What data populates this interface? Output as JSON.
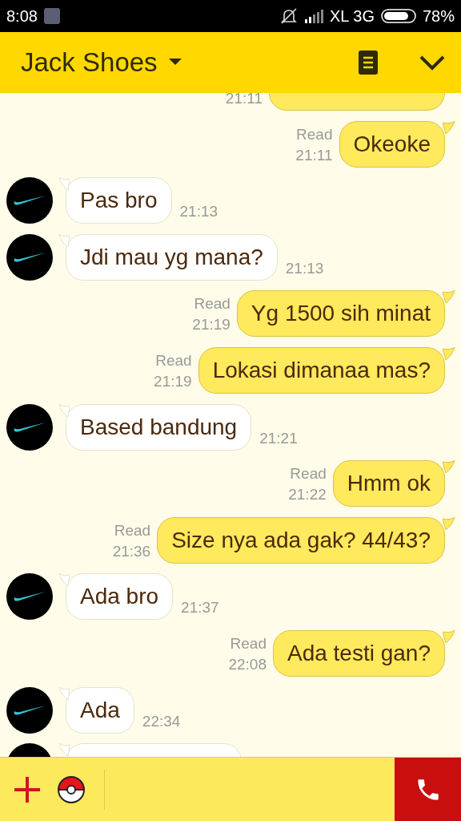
{
  "status_bar": {
    "time": "8:08",
    "network": "XL 3G",
    "battery": "78%"
  },
  "header": {
    "title": "Jack Shoes"
  },
  "messages": [
    {
      "kind": "clipped",
      "time": "21:11"
    },
    {
      "kind": "outgoing",
      "text": "Okeoke",
      "read": "Read",
      "time": "21:11"
    },
    {
      "kind": "incoming",
      "text": "Pas bro",
      "time": "21:13"
    },
    {
      "kind": "incoming",
      "text": "Jdi mau yg mana?",
      "time": "21:13"
    },
    {
      "kind": "outgoing",
      "text": "Yg 1500 sih minat",
      "read": "Read",
      "time": "21:19"
    },
    {
      "kind": "outgoing",
      "text": "Lokasi dimanaa mas?",
      "read": "Read",
      "time": "21:19"
    },
    {
      "kind": "incoming",
      "text": "Based bandung",
      "time": "21:21"
    },
    {
      "kind": "outgoing",
      "text": "Hmm ok",
      "read": "Read",
      "time": "21:22"
    },
    {
      "kind": "outgoing",
      "text": "Size nya ada gak? 44/43?",
      "read": "Read",
      "time": "21:36"
    },
    {
      "kind": "incoming",
      "text": "Ada bro",
      "time": "21:37"
    },
    {
      "kind": "outgoing",
      "text": "Ada testi gan?",
      "read": "Read",
      "time": "22:08"
    },
    {
      "kind": "incoming",
      "text": "Ada",
      "time": "22:34"
    },
    {
      "kind": "incoming-clipped"
    }
  ]
}
